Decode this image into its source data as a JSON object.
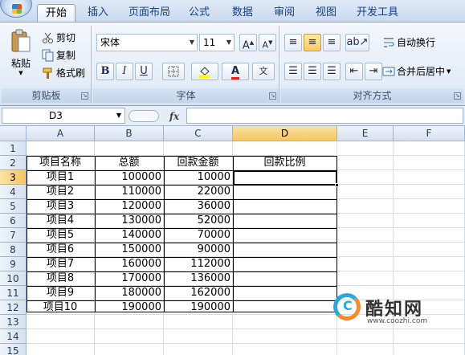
{
  "ribbon": {
    "tabs": [
      "开始",
      "插入",
      "页面布局",
      "公式",
      "数据",
      "审阅",
      "视图",
      "开发工具"
    ],
    "active_tab": "开始",
    "clipboard": {
      "paste_label": "粘贴",
      "cut_label": "剪切",
      "copy_label": "复制",
      "format_painter_label": "格式刷",
      "group_label": "剪贴板"
    },
    "font": {
      "font_name": "宋体",
      "font_size": "11",
      "bold": "B",
      "italic": "I",
      "underline": "U",
      "group_label": "字体"
    },
    "alignment": {
      "wrap_text_label": "自动换行",
      "merge_center_label": "合并后居中",
      "group_label": "对齐方式"
    }
  },
  "formula_bar": {
    "name_box": "D3",
    "fx_label": "fx",
    "formula": ""
  },
  "sheet": {
    "columns": [
      "A",
      "B",
      "C",
      "D",
      "E",
      "F"
    ],
    "rows": [
      "1",
      "2",
      "3",
      "4",
      "5",
      "6",
      "7",
      "8",
      "9",
      "10",
      "11",
      "12",
      "13",
      "14",
      "15"
    ],
    "selected_column": "D",
    "selected_row": "3",
    "headers": [
      "项目名称",
      "总额",
      "回款金额",
      "回款比例"
    ],
    "data": [
      [
        "项目1",
        "100000",
        "10000",
        ""
      ],
      [
        "项目2",
        "110000",
        "22000",
        ""
      ],
      [
        "项目3",
        "120000",
        "36000",
        ""
      ],
      [
        "项目4",
        "130000",
        "52000",
        ""
      ],
      [
        "项目5",
        "140000",
        "70000",
        ""
      ],
      [
        "项目6",
        "150000",
        "90000",
        ""
      ],
      [
        "项目7",
        "160000",
        "112000",
        ""
      ],
      [
        "项目8",
        "170000",
        "136000",
        ""
      ],
      [
        "项目9",
        "180000",
        "162000",
        ""
      ],
      [
        "项目10",
        "190000",
        "190000",
        ""
      ]
    ]
  },
  "watermark": {
    "title": "酷知网",
    "url": "www.coozhi.com"
  },
  "colors": {
    "selection_header": "#f6c55d",
    "ribbon_text": "#15428b",
    "grid_line": "#d6dde8"
  }
}
